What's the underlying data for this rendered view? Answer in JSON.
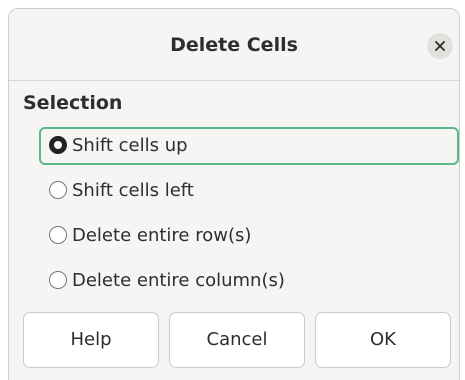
{
  "dialog": {
    "title": "Delete Cells",
    "close_icon": "close-icon"
  },
  "selection": {
    "label": "Selection",
    "options": [
      {
        "label": "Shift cells up",
        "checked": true
      },
      {
        "label": "Shift cells left",
        "checked": false
      },
      {
        "label": "Delete entire row(s)",
        "checked": false
      },
      {
        "label": "Delete entire column(s)",
        "checked": false
      }
    ]
  },
  "buttons": {
    "help": "Help",
    "cancel": "Cancel",
    "ok": "OK"
  },
  "colors": {
    "focus_ring": "#5cb88a",
    "dialog_bg": "#f6f5f4"
  }
}
